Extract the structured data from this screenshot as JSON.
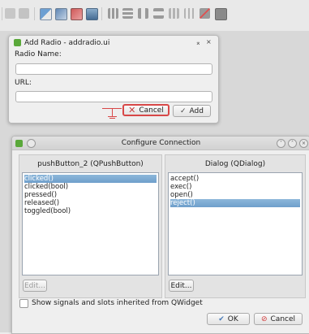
{
  "toolbar": {
    "icons": [
      "tool-a-icon",
      "tool-b-icon",
      "edit-widgets-icon",
      "edit-signals-slots-icon",
      "edit-buddies-icon",
      "edit-tab-order-icon",
      "layout-horizontal-icon",
      "layout-vertical-icon",
      "layout-splitter-h-icon",
      "layout-splitter-v-icon",
      "layout-grid-icon",
      "layout-form-icon",
      "break-layout-icon",
      "adjust-size-icon"
    ]
  },
  "add_radio": {
    "title": "Add Radio - addradio.ui",
    "radio_name_label": "Radio Name:",
    "radio_name_value": "",
    "url_label": "URL:",
    "url_value": "",
    "cancel_label": "Cancel",
    "add_label": "Add",
    "colors": {
      "highlight": "#d84848"
    }
  },
  "configure": {
    "title": "Configure Connection",
    "left_header": "pushButton_2 (QPushButton)",
    "right_header": "Dialog (QDialog)",
    "signals": [
      "clicked()",
      "clicked(bool)",
      "pressed()",
      "released()",
      "toggled(bool)"
    ],
    "selected_signal": 0,
    "slots": [
      "accept()",
      "exec()",
      "open()",
      "reject()"
    ],
    "selected_slot": 3,
    "edit_left": "Edit...",
    "edit_right": "Edit...",
    "inherited_label": "Show signals and slots inherited from QWidget",
    "ok_label": "OK",
    "cancel_label": "Cancel"
  }
}
